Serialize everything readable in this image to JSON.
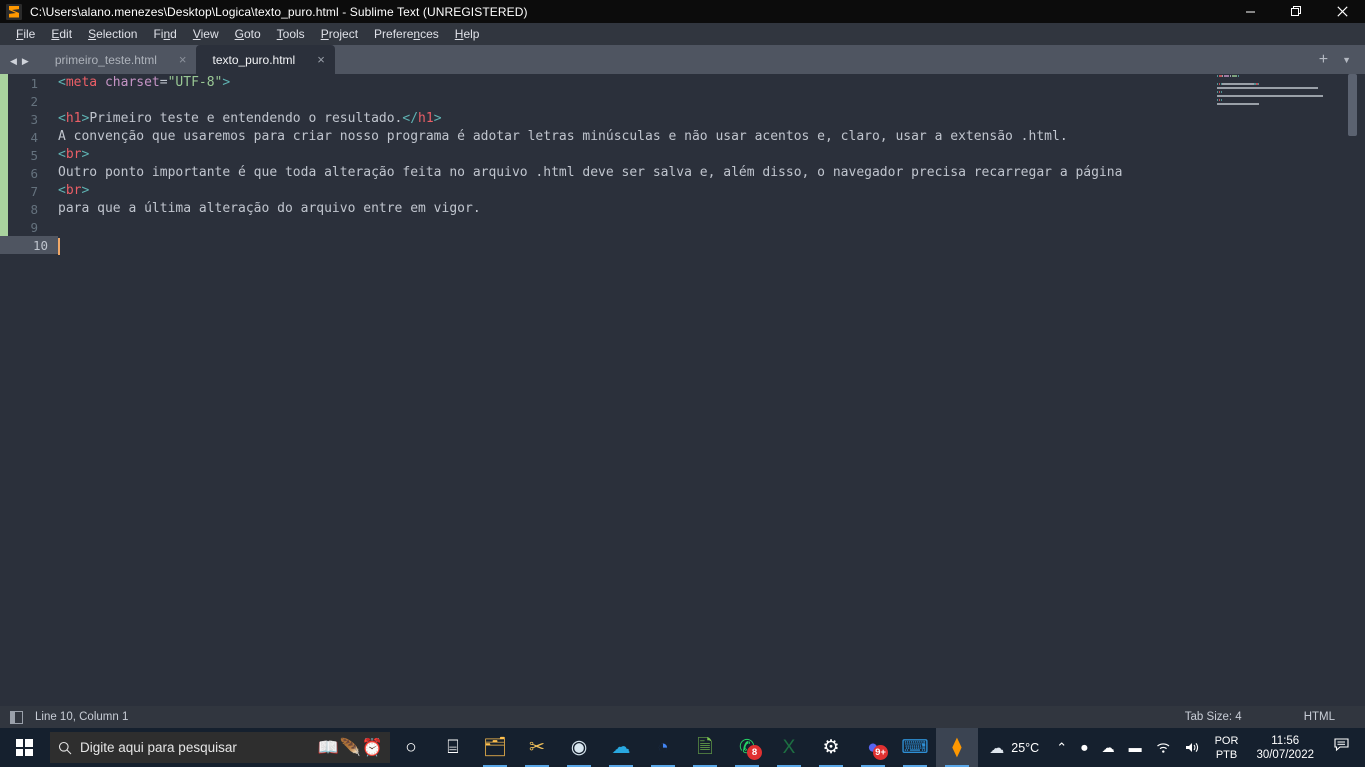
{
  "window": {
    "title": "C:\\Users\\alano.menezes\\Desktop\\Logica\\texto_puro.html - Sublime Text (UNREGISTERED)",
    "app_icon": "sublime-text-icon",
    "controls": {
      "minimize": "minimize-icon",
      "restore": "restore-icon",
      "close": "close-icon"
    }
  },
  "menubar": {
    "items": [
      {
        "label": "File",
        "mnemonic": "F"
      },
      {
        "label": "Edit",
        "mnemonic": "E"
      },
      {
        "label": "Selection",
        "mnemonic": "S"
      },
      {
        "label": "Find",
        "mnemonic": "n"
      },
      {
        "label": "View",
        "mnemonic": "V"
      },
      {
        "label": "Goto",
        "mnemonic": "G"
      },
      {
        "label": "Tools",
        "mnemonic": "T"
      },
      {
        "label": "Project",
        "mnemonic": "P"
      },
      {
        "label": "Preferences",
        "mnemonic": "n"
      },
      {
        "label": "Help",
        "mnemonic": "H"
      }
    ]
  },
  "tabbar": {
    "prev_arrow": "◀",
    "next_arrow": "▶",
    "close_glyph": "×",
    "new_tab_glyph": "+",
    "tab_list_glyph": "▼",
    "tabs": [
      {
        "label": "primeiro_teste.html",
        "active": false
      },
      {
        "label": "texto_puro.html",
        "active": true
      }
    ]
  },
  "editor": {
    "lines": [
      {
        "number": "1",
        "tokens": [
          {
            "t": "<",
            "c": "punc"
          },
          {
            "t": "meta",
            "c": "tag"
          },
          {
            "t": " ",
            "c": "plain"
          },
          {
            "t": "charset",
            "c": "attr"
          },
          {
            "t": "=",
            "c": "eq"
          },
          {
            "t": "\"UTF-8\"",
            "c": "str"
          },
          {
            "t": ">",
            "c": "punc"
          }
        ]
      },
      {
        "number": "2",
        "tokens": []
      },
      {
        "number": "3",
        "tokens": [
          {
            "t": "<",
            "c": "punc"
          },
          {
            "t": "h1",
            "c": "tag"
          },
          {
            "t": ">",
            "c": "punc"
          },
          {
            "t": "Primeiro teste e entendendo o resultado.",
            "c": "plain"
          },
          {
            "t": "</",
            "c": "punc"
          },
          {
            "t": "h1",
            "c": "tag"
          },
          {
            "t": ">",
            "c": "punc"
          }
        ]
      },
      {
        "number": "4",
        "tokens": [
          {
            "t": "A convenção que usaremos para criar nosso programa é adotar letras minúsculas e não usar acentos e, claro, usar a extensão .html.",
            "c": "plain"
          }
        ]
      },
      {
        "number": "5",
        "tokens": [
          {
            "t": "<",
            "c": "punc"
          },
          {
            "t": "br",
            "c": "tag"
          },
          {
            "t": ">",
            "c": "punc"
          }
        ]
      },
      {
        "number": "6",
        "tokens": [
          {
            "t": "Outro ponto importante é que toda alteração feita no arquivo .html deve ser salva e, além disso, o navegador precisa recarregar a página",
            "c": "plain"
          }
        ]
      },
      {
        "number": "7",
        "tokens": [
          {
            "t": "<",
            "c": "punc"
          },
          {
            "t": "br",
            "c": "tag"
          },
          {
            "t": ">",
            "c": "punc"
          }
        ]
      },
      {
        "number": "8",
        "tokens": [
          {
            "t": "para que a última alteração do arquivo entre em vigor.",
            "c": "plain"
          }
        ]
      },
      {
        "number": "9",
        "tokens": []
      },
      {
        "number": "10",
        "tokens": [],
        "current": true
      }
    ],
    "colors": {
      "background": "#2b303b",
      "punctuation": "#5fb3b3",
      "tag": "#ec5f67",
      "attribute": "#c594c5",
      "string": "#99c794",
      "text": "#c0c5ce",
      "caret": "#f0a868",
      "modified_marker": "#a9d39e",
      "current_line_gutter": "#4f5561"
    }
  },
  "statusbar": {
    "sidebar_toggle": "sidebar-toggle-icon",
    "caret_position": "Line 10, Column 1",
    "tab_size": "Tab Size: 4",
    "syntax": "HTML"
  },
  "taskbar": {
    "start": "windows-logo-icon",
    "search": {
      "icon": "search-icon",
      "placeholder": "Digite aqui para pesquisar",
      "decorations": [
        "book-icon",
        "feather-quill-icon",
        "clock-icon"
      ]
    },
    "items": [
      {
        "name": "cortana-icon",
        "glyph": "○",
        "color": "#ffffff",
        "badge": "",
        "running": false,
        "active": false
      },
      {
        "name": "task-view-icon",
        "glyph": "⌸",
        "color": "#ffffff",
        "badge": "",
        "running": false,
        "active": false
      },
      {
        "name": "file-explorer-icon",
        "glyph": "🗂",
        "color": "#ffc04d",
        "badge": "",
        "running": true,
        "active": false
      },
      {
        "name": "snip-sketch-icon",
        "glyph": "✂",
        "color": "#f0c05a",
        "badge": "",
        "running": true,
        "active": false
      },
      {
        "name": "browser-avatar-icon",
        "glyph": "◉",
        "color": "#d8e6ef",
        "badge": "",
        "running": true,
        "active": false
      },
      {
        "name": "azure-data-studio-icon",
        "glyph": "☁",
        "color": "#29a8e0",
        "badge": "",
        "running": true,
        "active": false
      },
      {
        "name": "google-chrome-icon",
        "glyph": "◔",
        "color": "#4285f4",
        "badge": "",
        "running": true,
        "active": false
      },
      {
        "name": "notepad-edit-icon",
        "glyph": "🗎",
        "color": "#7ec850",
        "badge": "",
        "running": true,
        "active": false
      },
      {
        "name": "whatsapp-icon",
        "glyph": "✆",
        "color": "#25d366",
        "badge": "8",
        "running": true,
        "active": false
      },
      {
        "name": "excel-icon",
        "glyph": "X",
        "color": "#1d6f42",
        "badge": "",
        "running": true,
        "active": false
      },
      {
        "name": "settings-gear-icon",
        "glyph": "⚙",
        "color": "#ffffff",
        "badge": "",
        "running": true,
        "active": false
      },
      {
        "name": "discord-icon",
        "glyph": "●",
        "color": "#5865f2",
        "badge": "9+",
        "running": true,
        "active": false
      },
      {
        "name": "vs-code-icon",
        "glyph": "⌨",
        "color": "#2e8fd4",
        "badge": "",
        "running": true,
        "active": false
      },
      {
        "name": "sublime-text-icon",
        "glyph": "⧫",
        "color": "#ff9800",
        "badge": "",
        "running": true,
        "active": true
      }
    ],
    "tray": {
      "weather_icon": "cloud-icon",
      "temperature": "25°C",
      "overflow_icon": "⌃",
      "camera_icon": "⏺",
      "onedrive_icon": "☁",
      "battery_icon": "▬",
      "wifi_icon": "◔",
      "volume_icon": "◂",
      "language_line1": "POR",
      "language_line2": "PTB",
      "time": "11:56",
      "date": "30/07/2022",
      "notifications_icon": "notification-center-icon"
    }
  }
}
